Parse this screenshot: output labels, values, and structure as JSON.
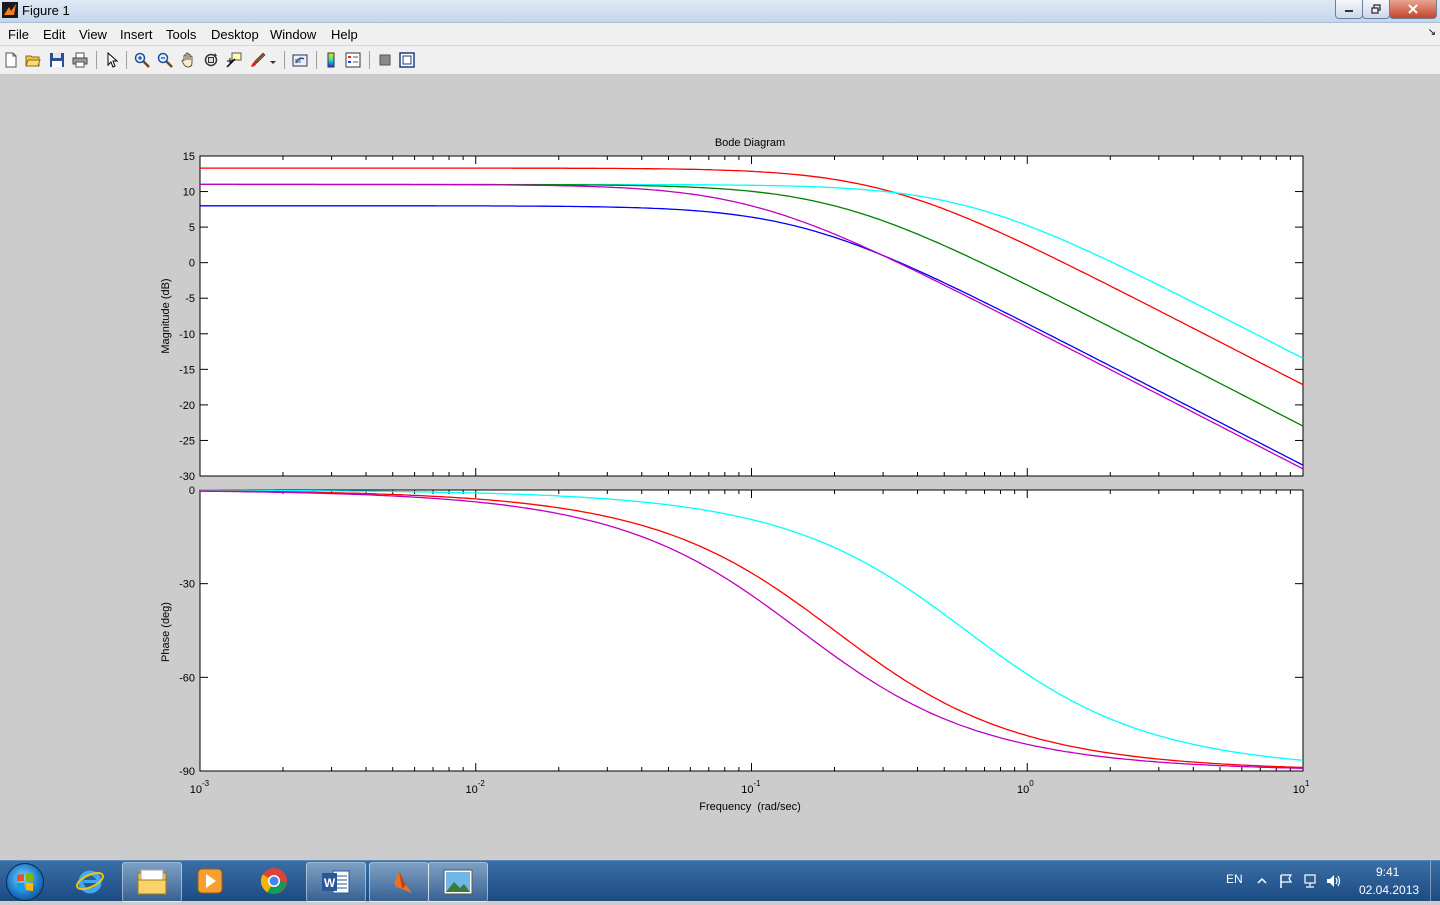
{
  "window": {
    "title": "Figure 1"
  },
  "menu": [
    "File",
    "Edit",
    "View",
    "Insert",
    "Tools",
    "Desktop",
    "Window",
    "Help"
  ],
  "toolbar_icons": [
    "new-figure-icon",
    "open-file-icon",
    "save-icon",
    "print-icon",
    "edit-plot-icon",
    "zoom-in-icon",
    "zoom-out-icon",
    "pan-icon",
    "rotate-3d-icon",
    "data-cursor-icon",
    "brush-icon",
    "link-plot-icon",
    "colorbar-icon",
    "legend-icon",
    "hide-plot-tools-icon",
    "show-plot-tools-icon"
  ],
  "chart_data": {
    "type": "line",
    "title": "Bode Diagram",
    "xlabel": "Frequency  (rad/sec)",
    "xscale": "log",
    "xlim": [
      0.001,
      10
    ],
    "x_ticks": [
      {
        "base": "10",
        "exp": "-3"
      },
      {
        "base": "10",
        "exp": "-2"
      },
      {
        "base": "10",
        "exp": "-1"
      },
      {
        "base": "10",
        "exp": "0"
      },
      {
        "base": "10",
        "exp": "1"
      }
    ],
    "magnitude": {
      "ylabel": "Magnitude (dB)",
      "ylim": [
        -30,
        15
      ],
      "y_ticks": [
        "15",
        "10",
        "5",
        "0",
        "-5",
        "-10",
        "-15",
        "-20",
        "-25",
        "-30"
      ],
      "series": [
        {
          "color": "#ff0000",
          "dc_gain_db": 13.3,
          "corner": 0.3,
          "order": 1
        },
        {
          "color": "#00ffff",
          "dc_gain_db": 11.0,
          "corner": 0.6,
          "order": 1
        },
        {
          "color": "#008000",
          "dc_gain_db": 11.0,
          "corner": 0.2,
          "order": 1
        },
        {
          "color": "#0000ff",
          "dc_gain_db": 8.0,
          "corner": 0.15,
          "order": 1
        },
        {
          "color": "#bf00bf",
          "dc_gain_db": 11.0,
          "corner": 0.1,
          "order": 1
        }
      ]
    },
    "phase": {
      "ylabel": "Phase (deg)",
      "ylim": [
        -90,
        0
      ],
      "y_ticks": [
        "0",
        "-30",
        "-60",
        "-90"
      ],
      "series": [
        {
          "color": "#00ffff",
          "corner": 0.6
        },
        {
          "color": "#ff0000",
          "corner": 0.2
        },
        {
          "color": "#bf00bf",
          "corner": 0.15
        }
      ]
    },
    "grid": false
  },
  "taskbar": {
    "apps": [
      "start-button",
      "internet-explorer-icon",
      "file-explorer-icon",
      "media-player-icon",
      "chrome-icon",
      "word-icon",
      "matlab-icon",
      "image-viewer-icon"
    ],
    "lang": "EN",
    "time": "9:41",
    "date": "02.04.2013"
  }
}
